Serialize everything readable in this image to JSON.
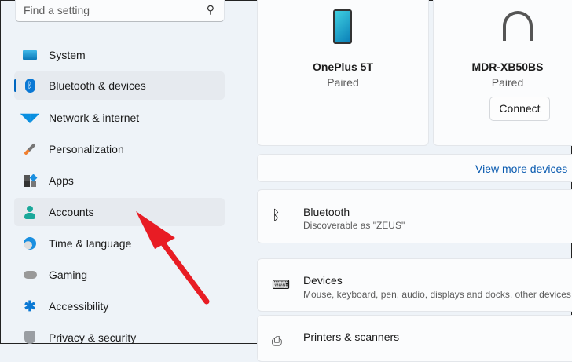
{
  "search": {
    "placeholder": "Find a setting",
    "icon": "search-icon"
  },
  "sidebar": {
    "items": [
      {
        "label": "System",
        "icon": "system-icon"
      },
      {
        "label": "Bluetooth & devices",
        "icon": "bluetooth-icon"
      },
      {
        "label": "Network & internet",
        "icon": "wifi-icon"
      },
      {
        "label": "Personalization",
        "icon": "brush-icon"
      },
      {
        "label": "Apps",
        "icon": "apps-icon"
      },
      {
        "label": "Accounts",
        "icon": "account-icon"
      },
      {
        "label": "Time & language",
        "icon": "clock-globe-icon"
      },
      {
        "label": "Gaming",
        "icon": "gamepad-icon"
      },
      {
        "label": "Accessibility",
        "icon": "accessibility-icon"
      },
      {
        "label": "Privacy & security",
        "icon": "shield-icon"
      }
    ]
  },
  "devices": [
    {
      "name": "OnePlus 5T",
      "status": "Paired"
    },
    {
      "name": "MDR-XB50BS",
      "status": "Paired",
      "action": "Connect"
    }
  ],
  "view_more": "View more devices",
  "rows": [
    {
      "title": "Bluetooth",
      "subtitle": "Discoverable as \"ZEUS\""
    },
    {
      "title": "Devices",
      "subtitle": "Mouse, keyboard, pen, audio, displays and docks, other devices"
    },
    {
      "title": "Printers & scanners"
    }
  ],
  "colors": {
    "accent": "#0067c0",
    "arrow": "#e81c24"
  }
}
